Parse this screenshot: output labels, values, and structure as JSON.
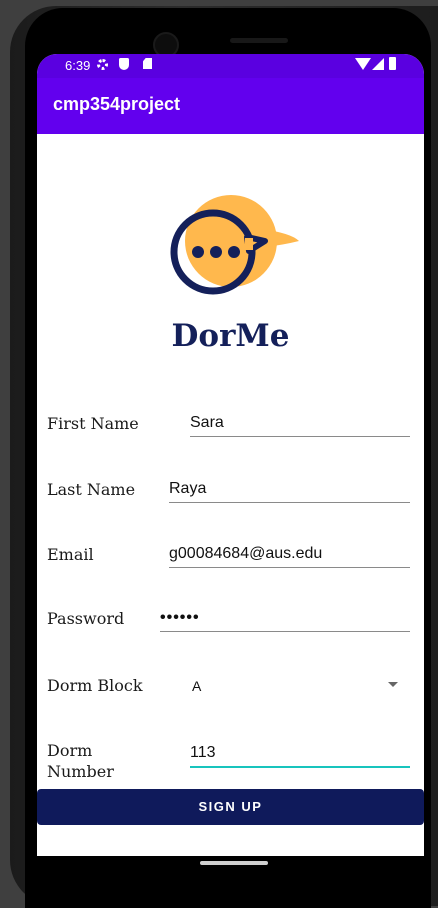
{
  "statusbar": {
    "time": "6:39",
    "icons": [
      "gear-icon",
      "shield-icon",
      "sd-card-icon",
      "wifi-icon",
      "signal-icon",
      "battery-icon"
    ]
  },
  "appbar": {
    "title": "cmp354project"
  },
  "brand": {
    "name": "DorMe"
  },
  "colors": {
    "statusbar": "#5a00e0",
    "appbar": "#6200ee",
    "brand": "#14205a",
    "logo_bubble": "#ffb84d",
    "button": "#0f1a5b",
    "focus_underline": "#18c4bd"
  },
  "form": {
    "first_name": {
      "label": "First Name",
      "value": "Sara"
    },
    "last_name": {
      "label": "Last Name",
      "value": "Raya"
    },
    "email": {
      "label": "Email",
      "value": "g00084684@aus.edu"
    },
    "password": {
      "label": "Password",
      "value": "••••••"
    },
    "dorm_block": {
      "label": "Dorm Block",
      "value": "A"
    },
    "dorm_number": {
      "label": "Dorm Number",
      "value": "113"
    }
  },
  "signup": {
    "label": "SIGN UP"
  }
}
